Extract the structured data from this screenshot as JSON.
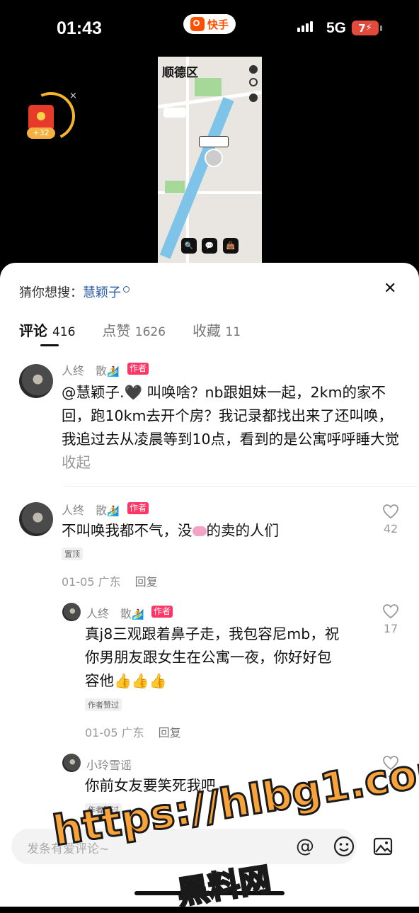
{
  "status_bar": {
    "time": "01:43",
    "app_name": "快手",
    "network": "5G",
    "battery": "7"
  },
  "red_packet": {
    "amount": "+32",
    "close": "×"
  },
  "video": {
    "map_title": "顺德区"
  },
  "sheet": {
    "suggest_label": "猜你想搜：",
    "suggest_keyword": "慧颖子",
    "close": "✕",
    "tabs": [
      {
        "label": "评论",
        "count": "416"
      },
      {
        "label": "点赞",
        "count": "1626"
      },
      {
        "label": "收藏",
        "count": "11"
      }
    ]
  },
  "comments": [
    {
      "user": "人终　散",
      "badge": "作者",
      "text": "@慧颖子.🖤 叫唤啥？nb跟姐妹一起，2km的家不回，跑10km去开个房？我记录都找出来了还叫唤，我追过去从凌晨等到10点，看到的是公寓呼呼睡大觉",
      "fold": "收起"
    },
    {
      "user": "人终　散",
      "badge": "作者",
      "text_a": "不叫唤我都不气，没",
      "text_b": "的卖的人们",
      "pin": "置顶",
      "date": "01-05 广东",
      "reply": "回复",
      "likes": "42"
    }
  ],
  "replies": [
    {
      "user": "人终　散",
      "badge": "作者",
      "text": "真j8三观跟着鼻子走，我包容尼mb，祝你男朋友跟女生在公寓一夜，你好好包容他",
      "thumbs": "👍👍👍",
      "tag": "作者赞过",
      "date": "01-05 广东",
      "reply": "回复",
      "likes": "17"
    },
    {
      "user": "小玲雪谣",
      "text": "你前女友要笑死我吧",
      "tag": "作者赞过",
      "likes": "7"
    }
  ],
  "input": {
    "placeholder": "发条有爱评论~"
  },
  "watermark": {
    "line1": "https://hlbg1.com",
    "line2": "黑料网"
  },
  "colors": {
    "author_badge": "#fe3666",
    "keyword": "#2d5ea6",
    "brand": "#ff5000",
    "watermark": "#f8a23a"
  }
}
